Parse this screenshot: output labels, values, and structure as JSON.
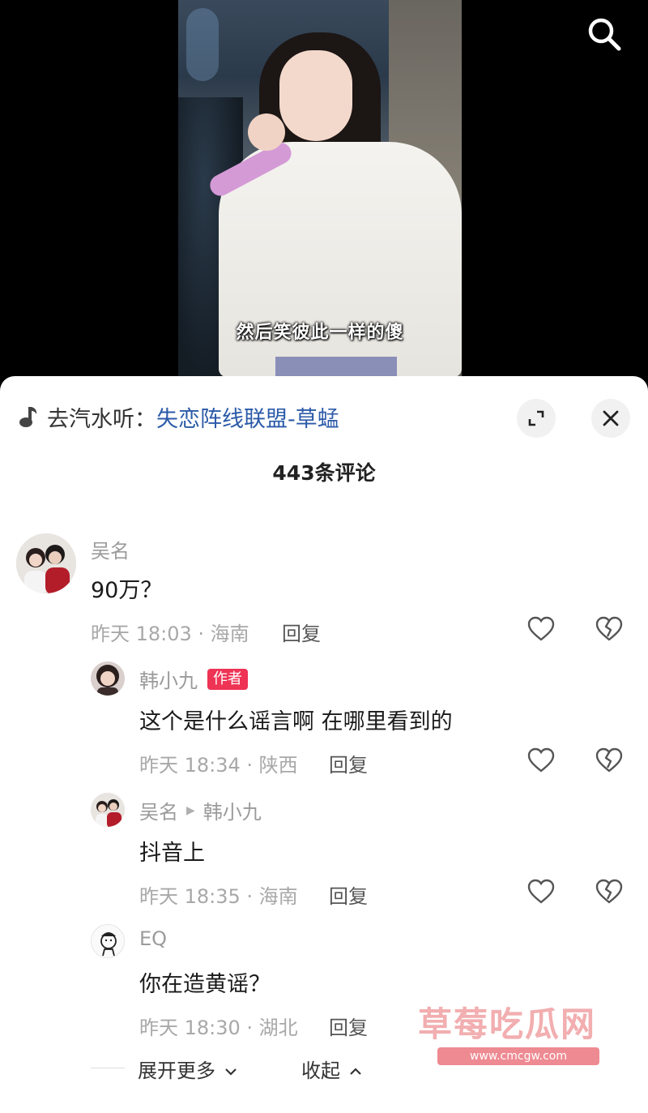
{
  "video": {
    "subtitle": "然后笑彼此一样的傻"
  },
  "music": {
    "prefix": "去汽水听：",
    "song": "失恋阵线联盟-草蜢"
  },
  "comments_header": {
    "count_label": "443条评论"
  },
  "comments": [
    {
      "user": "吴名",
      "text": "90万？",
      "meta": "昨天 18:03 · 海南",
      "reply_label": "回复"
    }
  ],
  "replies": [
    {
      "user": "韩小九",
      "badge": "作者",
      "text": "这个是什么谣言啊 在哪里看到的",
      "meta": "昨天 18:34 · 陕西",
      "reply_label": "回复"
    },
    {
      "user": "吴名",
      "reply_to": "韩小九",
      "text": "抖音上",
      "meta": "昨天 18:35 · 海南",
      "reply_label": "回复"
    },
    {
      "user": "EQ",
      "text": "你在造黄谣？",
      "meta": "昨天 18:30 · 湖北",
      "reply_label": "回复"
    }
  ],
  "footer": {
    "expand_more": "展开更多",
    "collapse": "收起"
  },
  "watermark": {
    "main": "草莓吃瓜网",
    "sub": "www.cmcgw.com"
  },
  "colors": {
    "link_blue": "#2b5aa8",
    "author_badge": "#ee3355",
    "meta_gray": "#a8a8a8"
  },
  "icons": [
    "search-icon",
    "music-note-icon",
    "expand-icon",
    "close-icon",
    "heart-icon",
    "broken-heart-icon",
    "chevron-down-icon",
    "chevron-up-icon"
  ]
}
